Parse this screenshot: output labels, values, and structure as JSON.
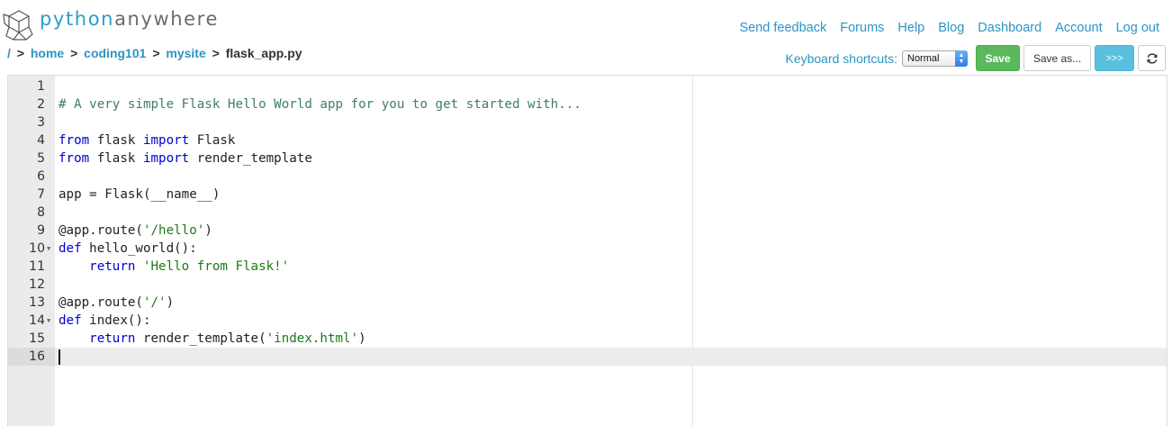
{
  "logo": {
    "text_python": "python",
    "text_anywhere": "anywhere",
    "icon": "pythonanywhere-logo-icon"
  },
  "nav": [
    {
      "label": "Send feedback"
    },
    {
      "label": "Forums"
    },
    {
      "label": "Help"
    },
    {
      "label": "Blog"
    },
    {
      "label": "Dashboard"
    },
    {
      "label": "Account"
    },
    {
      "label": "Log out"
    }
  ],
  "breadcrumb": {
    "root": "/",
    "parts": [
      "home",
      "coding101",
      "mysite"
    ],
    "file": "flask_app.py",
    "separator": ">"
  },
  "toolbar": {
    "keyboard_label": "Keyboard shortcuts:",
    "keyboard_mode": "Normal",
    "save_label": "Save",
    "save_as_label": "Save as...",
    "console_label": ">>>",
    "reload_icon": "reload-icon"
  },
  "editor": {
    "active_line": 16,
    "lines": [
      {
        "num": "1",
        "tokens": []
      },
      {
        "num": "2",
        "tokens": [
          {
            "t": "comment",
            "v": "# A very simple Flask Hello World app for you to get started with..."
          }
        ]
      },
      {
        "num": "3",
        "tokens": []
      },
      {
        "num": "4",
        "tokens": [
          {
            "t": "keyword",
            "v": "from"
          },
          {
            "t": "text",
            "v": " flask "
          },
          {
            "t": "keyword",
            "v": "import"
          },
          {
            "t": "text",
            "v": " Flask"
          }
        ]
      },
      {
        "num": "5",
        "tokens": [
          {
            "t": "keyword",
            "v": "from"
          },
          {
            "t": "text",
            "v": " flask "
          },
          {
            "t": "keyword",
            "v": "import"
          },
          {
            "t": "text",
            "v": " render_template"
          }
        ]
      },
      {
        "num": "6",
        "tokens": []
      },
      {
        "num": "7",
        "tokens": [
          {
            "t": "text",
            "v": "app = Flask(__name__)"
          }
        ]
      },
      {
        "num": "8",
        "tokens": []
      },
      {
        "num": "9",
        "tokens": [
          {
            "t": "text",
            "v": "@app.route("
          },
          {
            "t": "string",
            "v": "'/hello'"
          },
          {
            "t": "text",
            "v": ")"
          }
        ]
      },
      {
        "num": "10",
        "fold": true,
        "tokens": [
          {
            "t": "keyword",
            "v": "def"
          },
          {
            "t": "text",
            "v": " hello_world():"
          }
        ]
      },
      {
        "num": "11",
        "tokens": [
          {
            "t": "text",
            "v": "    "
          },
          {
            "t": "keyword",
            "v": "return"
          },
          {
            "t": "text",
            "v": " "
          },
          {
            "t": "string",
            "v": "'Hello from Flask!'"
          }
        ]
      },
      {
        "num": "12",
        "tokens": []
      },
      {
        "num": "13",
        "tokens": [
          {
            "t": "text",
            "v": "@app.route("
          },
          {
            "t": "string",
            "v": "'/'"
          },
          {
            "t": "text",
            "v": ")"
          }
        ]
      },
      {
        "num": "14",
        "fold": true,
        "tokens": [
          {
            "t": "keyword",
            "v": "def"
          },
          {
            "t": "text",
            "v": " index():"
          }
        ]
      },
      {
        "num": "15",
        "tokens": [
          {
            "t": "text",
            "v": "    "
          },
          {
            "t": "keyword",
            "v": "return"
          },
          {
            "t": "text",
            "v": " render_template("
          },
          {
            "t": "string",
            "v": "'index.html'"
          },
          {
            "t": "text",
            "v": ")"
          }
        ]
      },
      {
        "num": "16",
        "tokens": []
      }
    ]
  }
}
